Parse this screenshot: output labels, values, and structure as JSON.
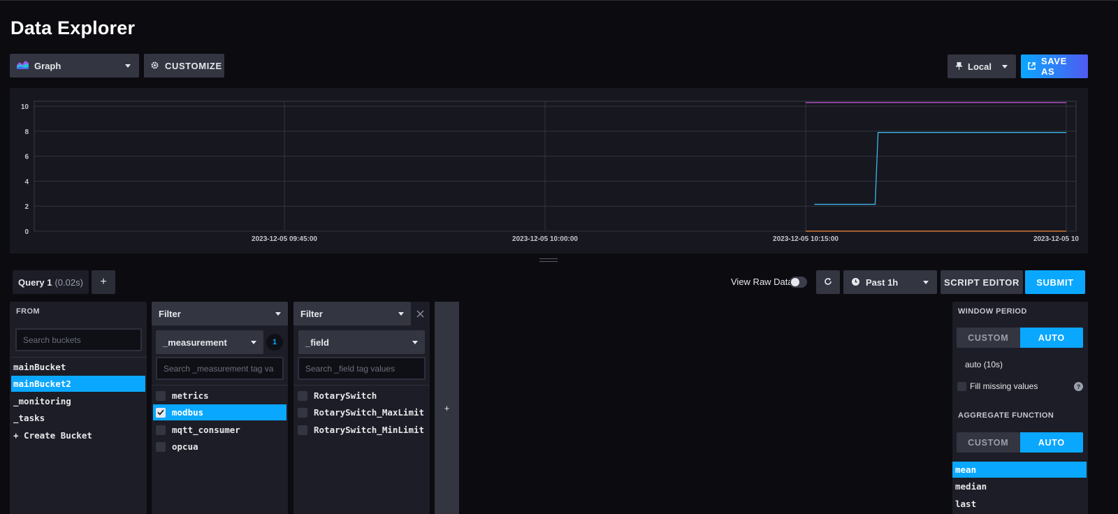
{
  "page": {
    "title": "Data Explorer"
  },
  "toolbar": {
    "graph_type": "Graph",
    "customize_label": "CUSTOMIZE",
    "timezone": "Local",
    "save_as_label": "SAVE AS"
  },
  "chart_data": {
    "type": "line",
    "y_ticks": [
      "0",
      "2",
      "4",
      "6",
      "8",
      "10"
    ],
    "ylim": [
      0,
      10.4
    ],
    "x_ticks": [
      "2023-12-05 09:45:00",
      "2023-12-05 10:00:00",
      "2023-12-05 10:15:00",
      "2023-12-05 10"
    ],
    "grid": true,
    "series": [
      {
        "color": "#b650c9",
        "points": [
          [
            "2023-12-05 10:15:00",
            10.3
          ],
          [
            "2023-12-05 10:30:00",
            10.3
          ]
        ]
      },
      {
        "color": "#3fb6e8",
        "points": [
          [
            "2023-12-05 10:15:30",
            2.15
          ],
          [
            "2023-12-05 10:19:00",
            2.15
          ],
          [
            "2023-12-05 10:19:10",
            7.9
          ],
          [
            "2023-12-05 10:30:00",
            7.9
          ]
        ]
      },
      {
        "color": "#f48d38",
        "points": [
          [
            "2023-12-05 10:15:00",
            0.0
          ],
          [
            "2023-12-05 10:30:00",
            0.0
          ]
        ]
      }
    ]
  },
  "query": {
    "tab_name": "Query 1",
    "tab_time": "(0.02s)",
    "add_label": "+",
    "view_raw_label": "View Raw Data",
    "time_range": "Past 1h",
    "script_editor_label": "SCRIPT EDITOR",
    "submit_label": "SUBMIT"
  },
  "from": {
    "header": "FROM",
    "search_placeholder": "Search buckets",
    "buckets": [
      "mainBucket",
      "mainBucket2",
      "_monitoring",
      "_tasks",
      "+ Create Bucket"
    ],
    "selected_index": 1
  },
  "filter1": {
    "header": "Filter",
    "key": "_measurement",
    "count": "1",
    "search_placeholder": "Search _measurement tag va",
    "values": [
      "metrics",
      "modbus",
      "mqtt_consumer",
      "opcua"
    ],
    "checked_index": 1
  },
  "filter2": {
    "header": "Filter",
    "key": "_field",
    "search_placeholder": "Search _field tag values",
    "values": [
      "RotarySwitch",
      "RotarySwitch_MaxLimit",
      "RotarySwitch_MinLimit"
    ]
  },
  "add_filter_label": "+",
  "aggregate": {
    "window_period_label": "WINDOW PERIOD",
    "custom_label": "CUSTOM",
    "auto_label": "AUTO",
    "auto_value": "auto (10s)",
    "fill_missing_label": "Fill missing values",
    "aggregate_function_label": "AGGREGATE FUNCTION",
    "functions": [
      "mean",
      "median",
      "last"
    ],
    "selected_function": 0
  },
  "colors": {
    "accent": "#0aa7ff",
    "background": "#0b0b10",
    "panel": "#1c1d26"
  }
}
